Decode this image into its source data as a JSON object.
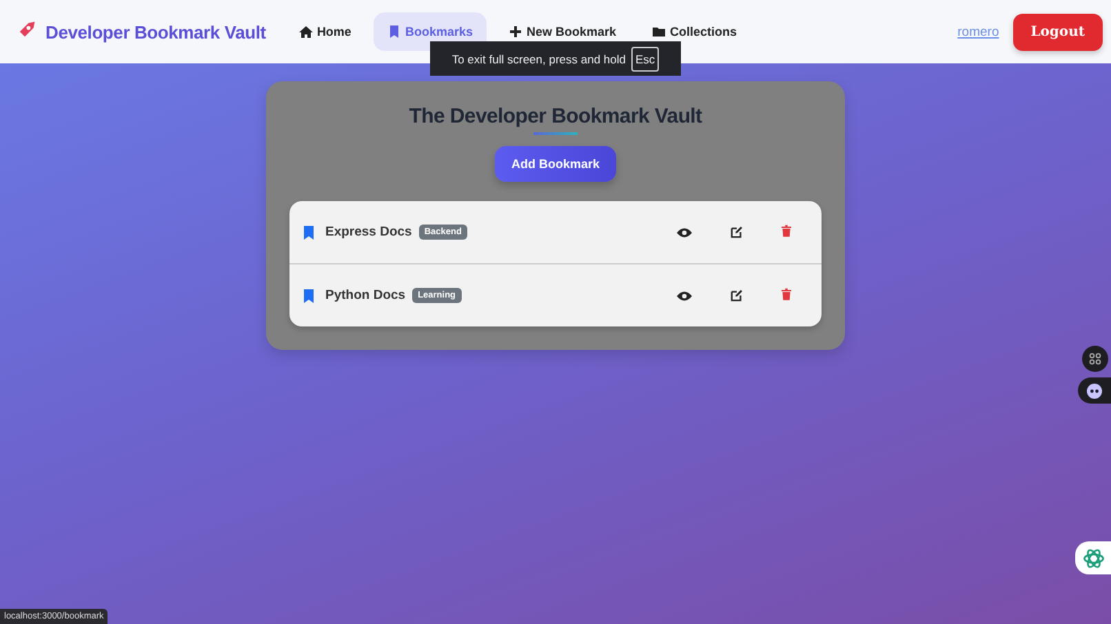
{
  "navbar": {
    "brand": "Developer Bookmark Vault",
    "links": [
      {
        "label": "Home",
        "kind": "home",
        "selected": false
      },
      {
        "label": "Bookmarks",
        "kind": "bookmark",
        "selected": true
      },
      {
        "label": "New Bookmark",
        "kind": "plus",
        "selected": false
      },
      {
        "label": "Collections",
        "kind": "folder",
        "selected": false
      }
    ],
    "user": "romero",
    "logout": "Logout"
  },
  "toast": {
    "text": "To exit full screen, press and hold",
    "key": "Esc"
  },
  "panel": {
    "title": "The Developer Bookmark Vault",
    "add_button": "Add Bookmark",
    "bookmarks": [
      {
        "name": "Express Docs",
        "tag": "Backend"
      },
      {
        "name": "Python Docs",
        "tag": "Learning"
      }
    ]
  },
  "status_bar": "localhost:3000/bookmark"
}
